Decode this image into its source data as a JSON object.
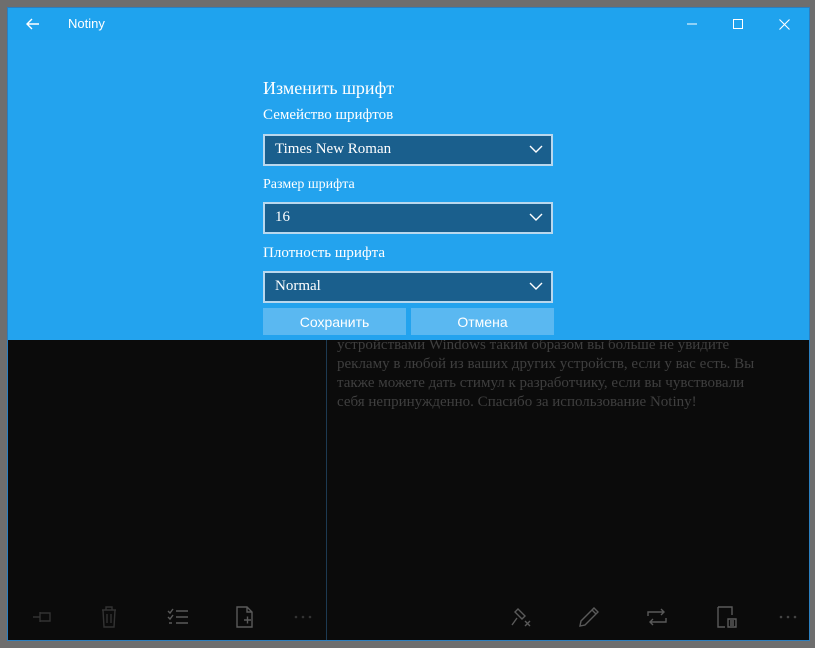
{
  "titlebar": {
    "app_title": "Notiny",
    "back_icon": "back-arrow-icon",
    "minimize_icon": "minimize-icon",
    "maximize_icon": "maximize-icon",
    "close_icon": "close-icon",
    "color": "#1fa3ee"
  },
  "dialog": {
    "title": "Изменить шрифт",
    "family_label": "Семейство шрифтов",
    "family_value": "Times New Roman",
    "size_label": "Размер шрифта",
    "size_value": "16",
    "weight_label": "Плотность шрифта",
    "weight_value": "Normal",
    "save_label": "Сохранить",
    "cancel_label": "Отмена",
    "background": "#23a3ee"
  },
  "note": {
    "lines": [
      "устройствами Windows таким образом вы больше не увидите",
      "рекламу в любой из ваших других устройств, если у вас есть. Вы",
      "также можете дать стимул к разработчику, если вы чувствовали",
      "себя непринужденно. Спасибо за использование Notiny!"
    ]
  },
  "left_toolbar": {
    "icons": [
      "pin-icon",
      "delete-icon",
      "checklist-icon",
      "new-note-icon",
      "more-icon"
    ]
  },
  "right_toolbar": {
    "icons": [
      "unpin-icon",
      "edit-icon",
      "sync-icon",
      "note-settings-icon",
      "more-icon"
    ]
  }
}
